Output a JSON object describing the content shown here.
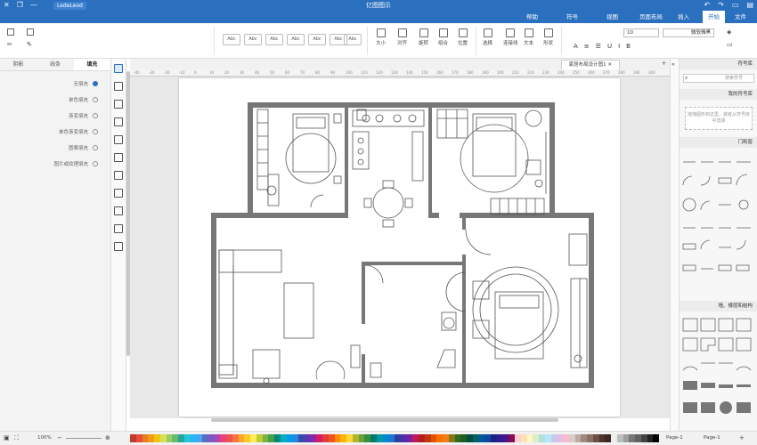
{
  "titlebar": {
    "title": "亿图图示",
    "badge": "LedeLeod",
    "win_min": "—",
    "win_max": "❐",
    "win_close": "✕"
  },
  "menubar": {
    "tabs": [
      "文件",
      "开始",
      "插入",
      "页面布局",
      "视图",
      "符号",
      "帮助"
    ],
    "active": "开始"
  },
  "ribbon": {
    "font_name": "微软雅黑",
    "font_size": "10",
    "buttons": [
      "选择",
      "文本",
      "连接线",
      "形状",
      "填充",
      "线条",
      "阴影",
      "位置",
      "组合",
      "旋转",
      "对齐",
      "大小"
    ],
    "style_labels": [
      "Abc",
      "Abc",
      "Abc",
      "Abc",
      "Abc",
      "Abc",
      "Abc"
    ]
  },
  "leftpanel": {
    "tabs": [
      "填充",
      "线条",
      "阴影"
    ],
    "active_tab": "填充",
    "fill_options": [
      "无填充",
      "单色填充",
      "渐变填充",
      "单色渐变填充",
      "图案填充",
      "图片或纹理填充"
    ],
    "selected_fill": "无填充"
  },
  "document": {
    "tab_label": "家居布局设计图1",
    "ruler_ticks": [
      "-40",
      "-30",
      "-20",
      "-10",
      "0",
      "10",
      "20",
      "30",
      "40",
      "50",
      "60",
      "70",
      "80",
      "90",
      "100",
      "110",
      "120",
      "130",
      "140",
      "150",
      "160",
      "170",
      "180",
      "190",
      "200",
      "210",
      "220",
      "230",
      "240",
      "250",
      "260",
      "270",
      "280",
      "290",
      "300"
    ]
  },
  "rightpanel": {
    "title": "符号库",
    "search_placeholder": "搜索符号",
    "my_library": "我的符号库",
    "drop_hint": "拖拽图形到这里，或者从符号库中选择",
    "sections": [
      "门和窗",
      "墙、楼层和结构"
    ]
  },
  "statusbar": {
    "page_label": "Page-1",
    "page_current": "Page-1",
    "zoom": "100%",
    "colors": [
      "#c0392b",
      "#e74c3c",
      "#e67e22",
      "#f39c12",
      "#f1c40f",
      "#d4e157",
      "#9ccc65",
      "#66bb6a",
      "#26a69a",
      "#26c6da",
      "#29b6f6",
      "#42a5f5",
      "#5c6bc0",
      "#7e57c2",
      "#ab47bc",
      "#ec407a",
      "#ef5350",
      "#ff7043",
      "#ffa726",
      "#ffca28",
      "#ffee58",
      "#c0ca33",
      "#7cb342",
      "#43a047",
      "#00897b",
      "#00acc1",
      "#039be5",
      "#1e88e5",
      "#3949ab",
      "#5e35b1",
      "#8e24aa",
      "#d81b60",
      "#e53935",
      "#f4511e",
      "#fb8c00",
      "#ffb300",
      "#fdd835",
      "#afb42b",
      "#689f38",
      "#388e3c",
      "#00796b",
      "#0097a7",
      "#0288d1",
      "#1976d2",
      "#303f9f",
      "#512da8",
      "#7b1fa2",
      "#c2185b",
      "#b71c1c",
      "#bf360c",
      "#e65100",
      "#ff6f00",
      "#f57f17",
      "#827717",
      "#33691e",
      "#1b5e20",
      "#004d40",
      "#006064",
      "#01579b",
      "#0d47a1",
      "#1a237e",
      "#311b92",
      "#4a148c",
      "#880e4f",
      "#ffcdd2",
      "#ffe0b2",
      "#fff9c4",
      "#dcedc8",
      "#b2dfdb",
      "#b3e5fc",
      "#c5cae9",
      "#e1bee7",
      "#f8bbd0",
      "#d7ccc8",
      "#bcaaa4",
      "#a1887f",
      "#8d6e63",
      "#6d4c41",
      "#4e342e",
      "#3e2723",
      "#eeeeee",
      "#bdbdbd",
      "#9e9e9e",
      "#757575",
      "#616161",
      "#424242",
      "#212121",
      "#000000"
    ]
  }
}
